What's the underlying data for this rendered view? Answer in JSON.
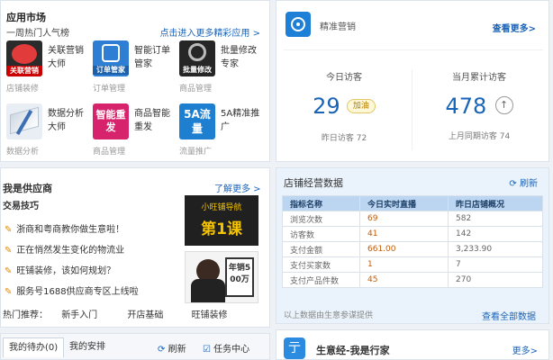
{
  "market": {
    "title": "应用市场",
    "subtitle": "一周热门人气榜",
    "more_link": "点击进入更多精彩应用 >",
    "apps": [
      {
        "name": "关联营销大师",
        "category": "店铺装修",
        "icon": "关联营销"
      },
      {
        "name": "智能订单管家",
        "category": "订单管理",
        "icon": "订单管家"
      },
      {
        "name": "批量修改专家",
        "category": "商品管理",
        "icon": "批量修改"
      },
      {
        "name": "数据分析大师",
        "category": "数据分析",
        "icon": ""
      },
      {
        "name": "商品智能重发",
        "category": "商品管理",
        "icon": "智能重发"
      },
      {
        "name": "5A精准推广",
        "category": "流量推广",
        "icon": "5A流量"
      }
    ]
  },
  "supplier": {
    "title": "我是供应商",
    "more_link": "了解更多 >",
    "sub_title": "交易技巧",
    "items": [
      "浙商和粤商教你做生意啦！",
      "正在悄然发生变化的物流业",
      "旺铺装修，该如何规划？",
      "服务号1688供应商专区上线啦"
    ],
    "hot_label": "热门推荐：",
    "hot_items": [
      "新手入门",
      "开店基础",
      "旺铺装修"
    ],
    "video1_top": "小旺铺导航",
    "video1_main": "第1课",
    "video2_caption": "年销500万"
  },
  "todo": {
    "tabs": [
      "我的待办(0)",
      "我的安排"
    ],
    "refresh": "刷新",
    "task_center": "任务中心"
  },
  "visitors": {
    "title": "精准营销",
    "more_link": "查看更多>",
    "today_label": "今日访客",
    "today_value": "29",
    "boost_button": "加油",
    "yesterday_label": "昨日访客",
    "yesterday_value": "72",
    "month_label": "当月累计访客",
    "month_value": "478",
    "last_month_label": "上月同期访客",
    "last_month_value": "74"
  },
  "store": {
    "title": "店铺经营数据",
    "refresh": "刷新",
    "headers": [
      "指标名称",
      "今日实时直播",
      "昨日店铺概况"
    ],
    "rows": [
      [
        "浏览次数",
        "69",
        "582"
      ],
      [
        "访客数",
        "41",
        "142"
      ],
      [
        "支付金额",
        "661.00",
        "3,233.90"
      ],
      [
        "支付买家数",
        "1",
        "7"
      ],
      [
        "支付产品件数",
        "45",
        "270"
      ]
    ],
    "footnote": "以上数据由生意参谋提供",
    "all_link": "查看全部数据"
  },
  "biz": {
    "title": "生意经-我是行家",
    "more_link": "更多>"
  }
}
